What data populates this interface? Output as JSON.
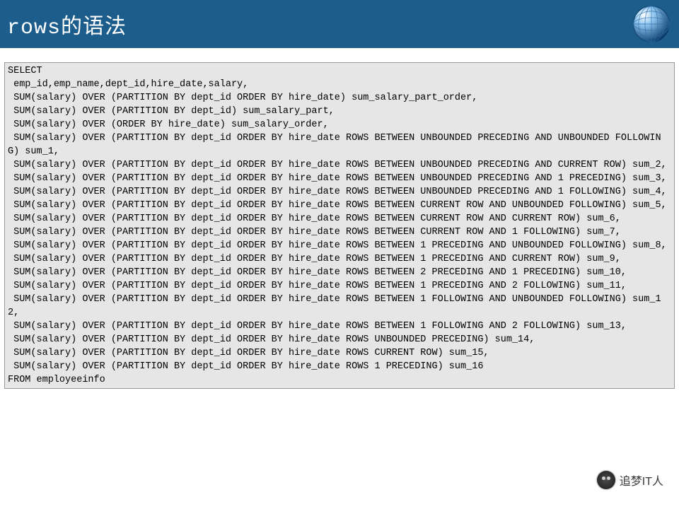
{
  "header": {
    "title": "rows的语法"
  },
  "code": {
    "sql": "SELECT\n emp_id,emp_name,dept_id,hire_date,salary,\n SUM(salary) OVER (PARTITION BY dept_id ORDER BY hire_date) sum_salary_part_order,\n SUM(salary) OVER (PARTITION BY dept_id) sum_salary_part,\n SUM(salary) OVER (ORDER BY hire_date) sum_salary_order,\n SUM(salary) OVER (PARTITION BY dept_id ORDER BY hire_date ROWS BETWEEN UNBOUNDED PRECEDING AND UNBOUNDED FOLLOWING) sum_1,\n SUM(salary) OVER (PARTITION BY dept_id ORDER BY hire_date ROWS BETWEEN UNBOUNDED PRECEDING AND CURRENT ROW) sum_2,\n SUM(salary) OVER (PARTITION BY dept_id ORDER BY hire_date ROWS BETWEEN UNBOUNDED PRECEDING AND 1 PRECEDING) sum_3,\n SUM(salary) OVER (PARTITION BY dept_id ORDER BY hire_date ROWS BETWEEN UNBOUNDED PRECEDING AND 1 FOLLOWING) sum_4,\n SUM(salary) OVER (PARTITION BY dept_id ORDER BY hire_date ROWS BETWEEN CURRENT ROW AND UNBOUNDED FOLLOWING) sum_5,\n SUM(salary) OVER (PARTITION BY dept_id ORDER BY hire_date ROWS BETWEEN CURRENT ROW AND CURRENT ROW) sum_6,\n SUM(salary) OVER (PARTITION BY dept_id ORDER BY hire_date ROWS BETWEEN CURRENT ROW AND 1 FOLLOWING) sum_7,\n SUM(salary) OVER (PARTITION BY dept_id ORDER BY hire_date ROWS BETWEEN 1 PRECEDING AND UNBOUNDED FOLLOWING) sum_8,\n SUM(salary) OVER (PARTITION BY dept_id ORDER BY hire_date ROWS BETWEEN 1 PRECEDING AND CURRENT ROW) sum_9,\n SUM(salary) OVER (PARTITION BY dept_id ORDER BY hire_date ROWS BETWEEN 2 PRECEDING AND 1 PRECEDING) sum_10,\n SUM(salary) OVER (PARTITION BY dept_id ORDER BY hire_date ROWS BETWEEN 1 PRECEDING AND 2 FOLLOWING) sum_11,\n SUM(salary) OVER (PARTITION BY dept_id ORDER BY hire_date ROWS BETWEEN 1 FOLLOWING AND UNBOUNDED FOLLOWING) sum_12,\n SUM(salary) OVER (PARTITION BY dept_id ORDER BY hire_date ROWS BETWEEN 1 FOLLOWING AND 2 FOLLOWING) sum_13,\n SUM(salary) OVER (PARTITION BY dept_id ORDER BY hire_date ROWS UNBOUNDED PRECEDING) sum_14,\n SUM(salary) OVER (PARTITION BY dept_id ORDER BY hire_date ROWS CURRENT ROW) sum_15,\n SUM(salary) OVER (PARTITION BY dept_id ORDER BY hire_date ROWS 1 PRECEDING) sum_16\nFROM employeeinfo"
  },
  "watermark": {
    "text": "追梦IT人"
  }
}
